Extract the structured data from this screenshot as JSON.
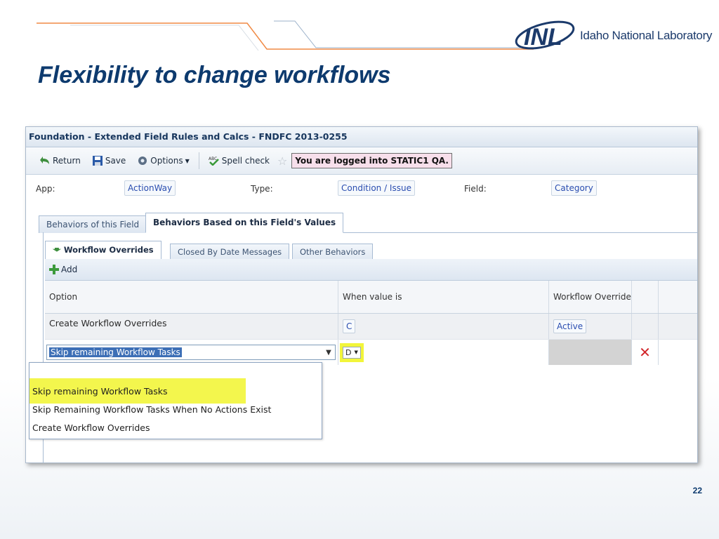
{
  "slide": {
    "title": "Flexibility to change workflows",
    "logo_text": "Idaho National Laboratory",
    "page_number": "22",
    "accent_color": "#0d3a6e",
    "line_color": "#f08a45"
  },
  "app": {
    "window_title": "Foundation - Extended Field Rules and Calcs - FNDFC 2013-0255",
    "toolbar": {
      "return_label": "Return",
      "save_label": "Save",
      "options_label": "Options",
      "spell_label": "Spell check",
      "login_message": "You are logged into STATIC1 QA."
    },
    "meta": {
      "app_label": "App:",
      "app_value": "ActionWay",
      "type_label": "Type:",
      "type_value": "Condition / Issue",
      "field_label": "Field:",
      "field_value": "Category"
    },
    "outer_tabs": [
      "Behaviors of this Field",
      "Behaviors Based on this Field's Values"
    ],
    "inner_tabs": [
      "Workflow Overrides",
      "Closed By Date Messages",
      "Other Behaviors"
    ],
    "add_label": "Add",
    "grid": {
      "headers": [
        "Option",
        "When value is",
        "Workflow Override"
      ],
      "row1": {
        "option": "Create Workflow Overrides",
        "when": "C",
        "override": "Active"
      },
      "row2": {
        "option": "Skip remaining Workflow Tasks",
        "when": "D"
      }
    },
    "dropdown_options": [
      "Skip remaining Workflow Tasks",
      "Skip Remaining Workflow Tasks When No Actions Exist",
      "Create Workflow Overrides"
    ],
    "highlight_color": "#f2f53a"
  }
}
